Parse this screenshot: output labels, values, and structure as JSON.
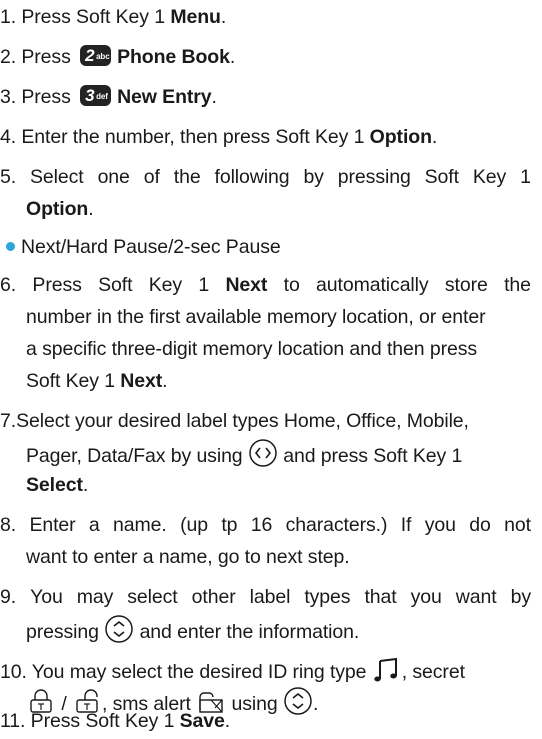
{
  "steps": {
    "s1": {
      "pre": "1. Press Soft Key 1 ",
      "bold": "Menu",
      "post": "."
    },
    "s2": {
      "pre": "2. Press",
      "key_digit": "2",
      "key_letters": "abc",
      "bold": "Phone Book",
      "post": "."
    },
    "s3": {
      "pre": "3. Press",
      "key_digit": "3",
      "key_letters": "def",
      "bold": "New Entry",
      "post": "."
    },
    "s4": {
      "pre": "4. Enter the number, then press Soft Key 1 ",
      "bold": "Option",
      "post": "."
    },
    "s5": {
      "line1_words": [
        "5.",
        "Select",
        "one",
        "of",
        "the",
        "following",
        "by",
        "pressing",
        "Soft",
        "Key",
        "1"
      ],
      "bold": "Option",
      "post": "."
    },
    "bullet": "Next/Hard Pause/2-sec Pause",
    "s6": {
      "line1_pre": [
        "6.",
        "Press",
        "Soft",
        "Key",
        "1"
      ],
      "line1_bold": "Next",
      "line1_post": [
        "to",
        "automatically",
        "store",
        "the"
      ],
      "line2": "number in the first available memory location, or enter",
      "line3": "a specific three-digit memory location and  then press",
      "line4_pre": "Soft Key 1 ",
      "line4_bold": "Next",
      "line4_post": "."
    },
    "s7": {
      "line1": "7.Select your desired label types Home, Office, Mobile,",
      "line2_pre": "Pager, Data/Fax by using",
      "line2_post": "and press Soft Key 1",
      "bold": "Select",
      "post": "."
    },
    "s8": {
      "line1_words": [
        "8.",
        "Enter",
        "a",
        "name.",
        "(up",
        "tp",
        "16",
        "characters.)",
        "If",
        "you",
        "do",
        "not"
      ],
      "line2": "want to  enter a name, go to next step."
    },
    "s9": {
      "line1_words": [
        "9.",
        "You",
        "may",
        "select",
        "other",
        "label",
        "types",
        "that",
        "you",
        "want",
        "by"
      ],
      "line2_pre": "pressing",
      "line2_post": "and enter the information."
    },
    "s10": {
      "line1_pre": "10. You may select the desired ID ring type",
      "line1_post": ", secret",
      "line2_sep": "/",
      "line2_mid": ", sms alert",
      "line2_using": "using",
      "line2_end": "."
    },
    "s11": {
      "pre": "11. Press Soft Key 1 ",
      "bold": "Save",
      "post": "."
    }
  },
  "icons": {
    "keypad_key": "keypad-key-icon",
    "nav_lr": "nav-left-right-icon",
    "nav_ud": "nav-up-down-icon",
    "ring": "ring-note-icon",
    "lock": "lock-icon",
    "mail": "sms-alert-icon"
  },
  "colors": {
    "bullet": "#2aa6d8",
    "text": "#1a1a1a",
    "key_bg": "#232323"
  }
}
